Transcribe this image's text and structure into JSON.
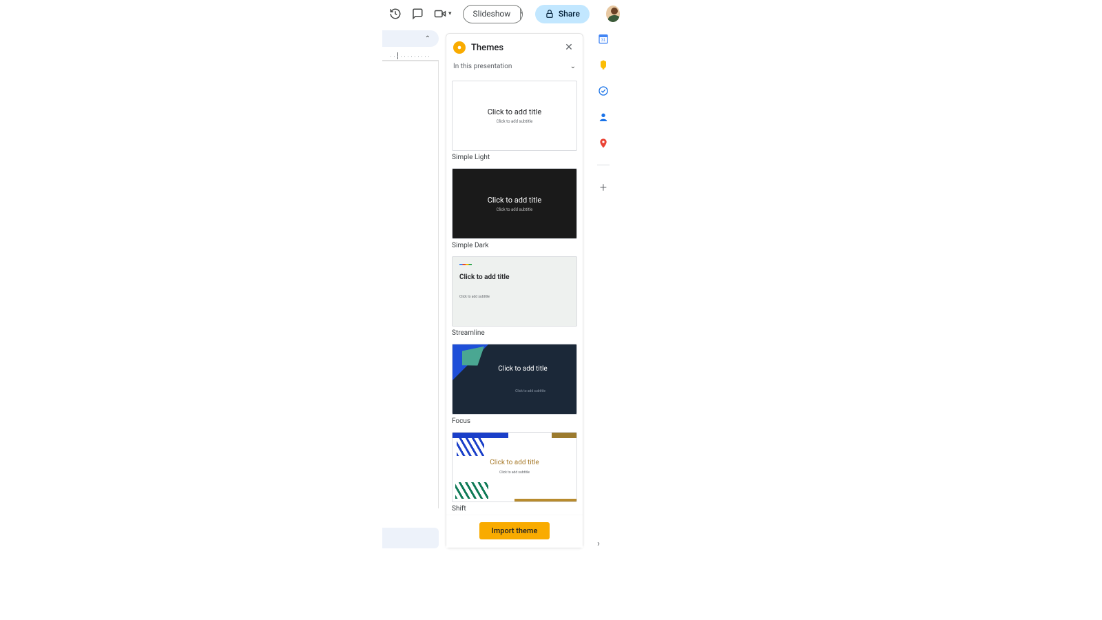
{
  "toolbar": {
    "slideshow_label": "Slideshow",
    "share_label": "Share"
  },
  "themes_panel": {
    "title": "Themes",
    "selector_label": "In this presentation",
    "placeholder_title": "Click to add title",
    "placeholder_subtitle": "Click to add subtitle",
    "import_label": "Import theme",
    "items": [
      {
        "name": "Simple Light"
      },
      {
        "name": "Simple Dark"
      },
      {
        "name": "Streamline"
      },
      {
        "name": "Focus"
      },
      {
        "name": "Shift"
      }
    ]
  }
}
